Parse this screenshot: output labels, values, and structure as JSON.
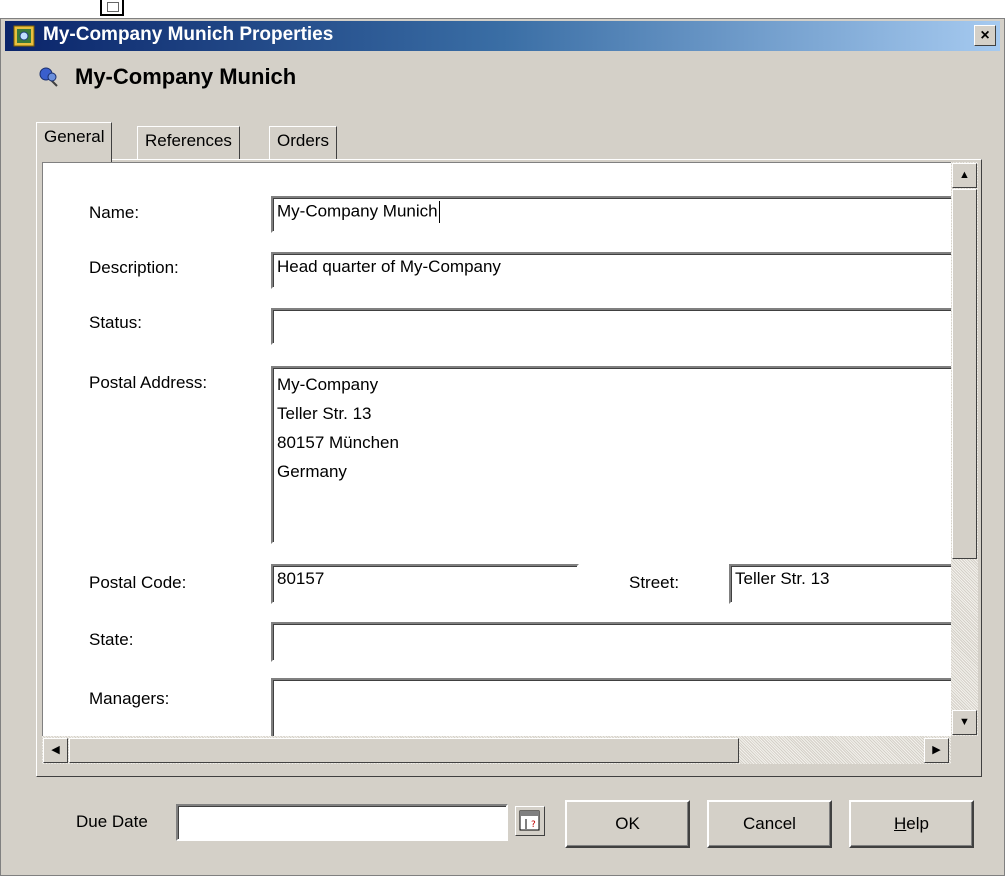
{
  "dialog": {
    "title": "My-Company Munich Properties",
    "close_label": "×",
    "object_name": "My-Company Munich"
  },
  "tabs": [
    {
      "label": "General",
      "active": true
    },
    {
      "label": "References",
      "active": false
    },
    {
      "label": "Orders",
      "active": false
    }
  ],
  "form": {
    "name_label": "Name:",
    "name_value": "My-Company Munich",
    "description_label": "Description:",
    "description_value": "Head quarter of My-Company",
    "status_label": "Status:",
    "status_value": "",
    "postal_address_label": "Postal Address:",
    "postal_address_lines": [
      "My-Company",
      "Teller Str. 13",
      "80157 München",
      "Germany"
    ],
    "postal_code_label": "Postal Code:",
    "postal_code_value": "80157",
    "street_label": "Street:",
    "street_value": "Teller Str. 13",
    "state_label": "State:",
    "state_value": "",
    "managers_label": "Managers:",
    "managers_value": ""
  },
  "footer": {
    "due_date_label": "Due Date",
    "due_date_value": "",
    "ok_label": "OK",
    "cancel_label": "Cancel",
    "help_label": "Help",
    "help_mnemonic": "H",
    "help_rest": "elp"
  },
  "icons": {
    "app": "properties-app-icon",
    "object": "pushpin-icon",
    "calendar": "calendar-icon"
  }
}
